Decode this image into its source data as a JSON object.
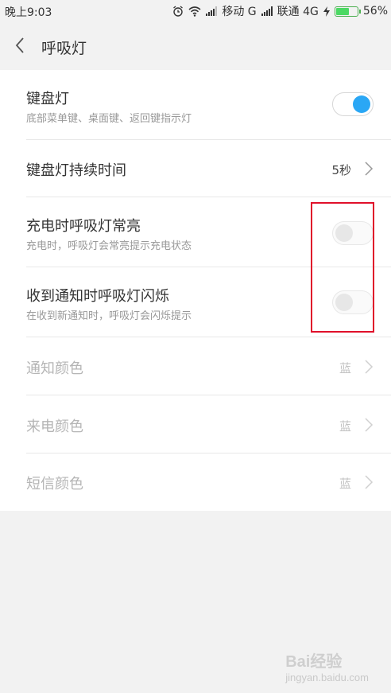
{
  "status_bar": {
    "time": "晚上9:03",
    "carrier1": "移动 G",
    "carrier2": "联通 4G",
    "battery": "56%",
    "battery_level": 0.56
  },
  "header": {
    "title": "呼吸灯"
  },
  "settings": [
    {
      "title": "键盘灯",
      "subtitle": "底部菜单键、桌面键、返回键指示灯",
      "toggle": true
    },
    {
      "title": "键盘灯持续时间",
      "value": "5秒"
    },
    {
      "title": "充电时呼吸灯常亮",
      "subtitle": "充电时，呼吸灯会常亮提示充电状态",
      "toggle": false
    },
    {
      "title": "收到通知时呼吸灯闪烁",
      "subtitle": "在收到新通知时，呼吸灯会闪烁提示",
      "toggle": false
    },
    {
      "title": "通知颜色",
      "value": "蓝",
      "disabled": true
    },
    {
      "title": "来电颜色",
      "value": "蓝",
      "disabled": true
    },
    {
      "title": "短信颜色",
      "value": "蓝",
      "disabled": true
    }
  ],
  "watermark": {
    "brand": "Bai",
    "brand2": "经验",
    "url": "jingyan.baidu.com"
  },
  "colors": {
    "accent": "#2aa7f5",
    "highlight": "#e0102a"
  }
}
